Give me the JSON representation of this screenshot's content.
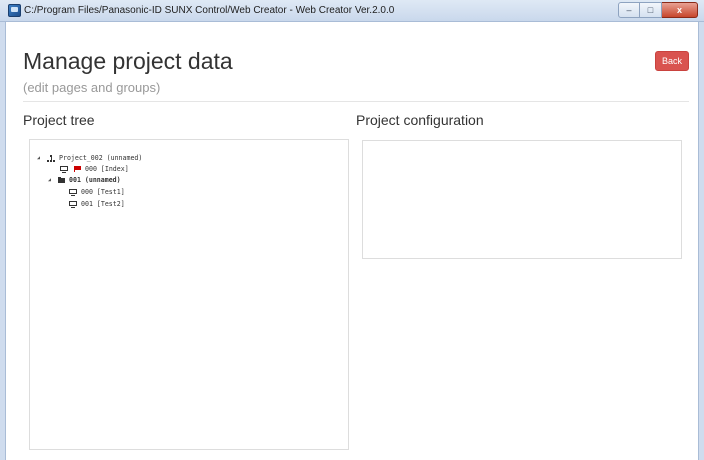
{
  "window": {
    "title": "C:/Program Files/Panasonic-ID SUNX Control/Web Creator - Web Creator Ver.2.0.0",
    "controls": {
      "minimize": "–",
      "maximize": "□",
      "close": "x"
    }
  },
  "header": {
    "title": "Manage project data",
    "subtitle": "(edit pages and groups)",
    "back_label": "Back",
    "back_color": "#d9534f"
  },
  "project_tree": {
    "heading": "Project tree",
    "nodes": [
      {
        "label": "Project_002 (unnamed)",
        "icon": "sitemap-icon",
        "expanded": true
      },
      {
        "label": "000 [Index]",
        "icon": "monitor-icon",
        "badge": "flag-icon",
        "badge_color": "#cc0000"
      },
      {
        "label": "001 (unnamed)",
        "icon": "folder-icon",
        "expanded": true,
        "bold": true
      },
      {
        "label": "000 [Test1]",
        "icon": "monitor-icon"
      },
      {
        "label": "001 [Test2]",
        "icon": "monitor-icon"
      }
    ]
  },
  "project_configuration": {
    "heading": "Project configuration"
  }
}
